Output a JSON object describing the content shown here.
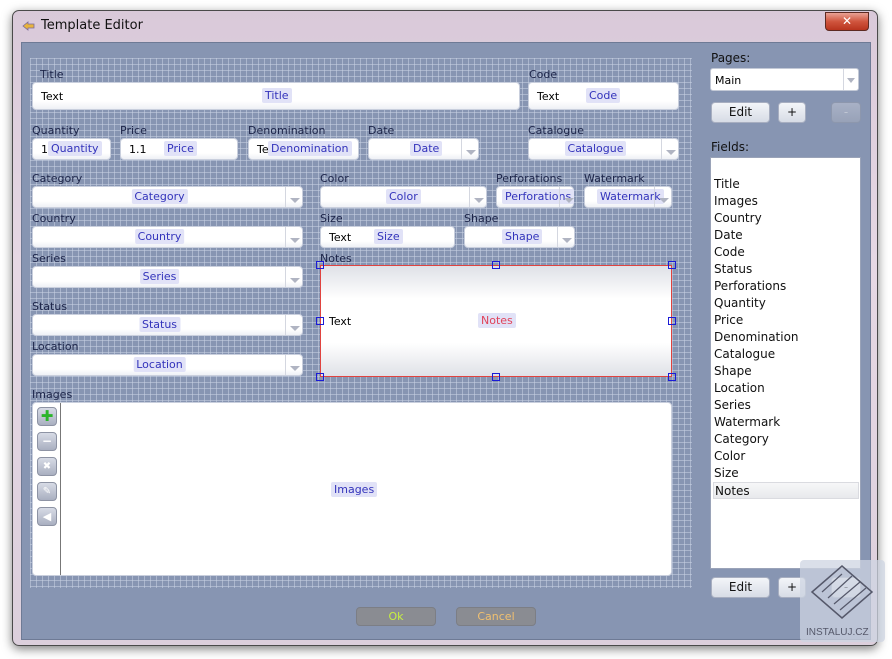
{
  "window": {
    "title": "Template Editor",
    "close_label": "✕"
  },
  "form": {
    "title": {
      "label": "Title",
      "value": "Text",
      "tag": "Title"
    },
    "code": {
      "label": "Code",
      "value": "Text",
      "tag": "Code"
    },
    "quantity": {
      "label": "Quantity",
      "value": "1",
      "tag": "Quantity"
    },
    "price": {
      "label": "Price",
      "value": "1.1",
      "tag": "Price"
    },
    "denomination": {
      "label": "Denomination",
      "value": "Te",
      "tag": "Denomination"
    },
    "date": {
      "label": "Date",
      "tag": "Date"
    },
    "catalogue": {
      "label": "Catalogue",
      "tag": "Catalogue"
    },
    "category": {
      "label": "Category",
      "tag": "Category"
    },
    "color": {
      "label": "Color",
      "tag": "Color"
    },
    "perforations": {
      "label": "Perforations",
      "tag": "Perforations"
    },
    "watermark": {
      "label": "Watermark",
      "tag": "Watermark"
    },
    "country": {
      "label": "Country",
      "tag": "Country"
    },
    "size": {
      "label": "Size",
      "value": "Text",
      "tag": "Size"
    },
    "shape": {
      "label": "Shape",
      "tag": "Shape"
    },
    "series": {
      "label": "Series",
      "tag": "Series"
    },
    "notes": {
      "label": "Notes",
      "value": "Text",
      "tag": "Notes"
    },
    "status": {
      "label": "Status",
      "tag": "Status"
    },
    "location": {
      "label": "Location",
      "tag": "Location"
    },
    "images": {
      "label": "Images",
      "tag": "Images",
      "tools": [
        "add-icon",
        "remove-icon",
        "delete-icon",
        "edit-icon",
        "back-icon"
      ]
    }
  },
  "sidebar": {
    "pages_label": "Pages:",
    "pages_selected": "Main",
    "pages_edit": "Edit",
    "pages_add": "+",
    "pages_remove": "-",
    "fields_label": "Fields:",
    "fields": [
      "Title",
      "Images",
      "Country",
      "Date",
      "Code",
      "Status",
      "Perforations",
      "Quantity",
      "Price",
      "Denomination",
      "Catalogue",
      "Shape",
      "Location",
      "Series",
      "Watermark",
      "Category",
      "Color",
      "Size",
      "Notes"
    ],
    "selected_field": "Notes",
    "fields_edit": "Edit",
    "fields_add": "+",
    "fields_remove": "-"
  },
  "buttons": {
    "ok": "Ok",
    "cancel": "Cancel",
    "ok_color": "#c8f040",
    "cancel_color": "#f0c070"
  },
  "watermark_text": "INSTALUJ.CZ"
}
